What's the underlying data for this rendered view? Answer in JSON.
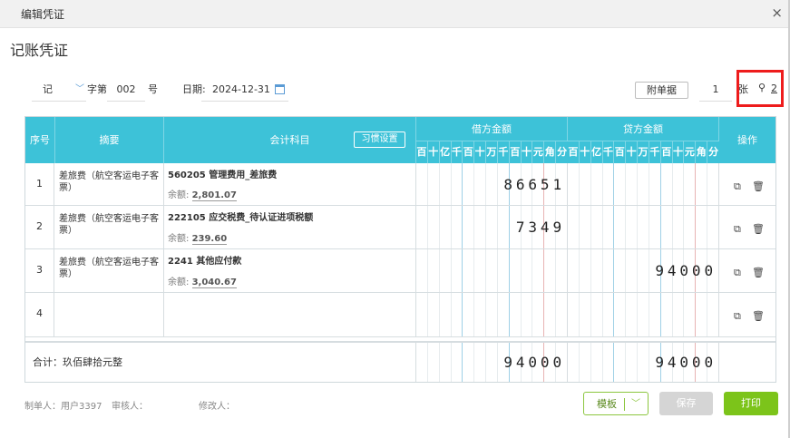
{
  "dialog": {
    "title": "编辑凭证",
    "close": "×"
  },
  "page_title": "记账凭证",
  "meta": {
    "voucher_type": "记",
    "zi_label": "字第",
    "voucher_number": "002",
    "hao_label": "号",
    "date_label": "日期:",
    "date_value": "2024-12-31",
    "attach_button": "附单据",
    "attach_count": "1",
    "zhang_label": "张",
    "link_count": "2"
  },
  "table": {
    "headers": {
      "index": "序号",
      "summary": "摘要",
      "account": "会计科目",
      "habit_button": "习惯设置",
      "debit": "借方金额",
      "credit": "贷方金额",
      "ops": "操作"
    },
    "digit_units": [
      "百",
      "十",
      "亿",
      "千",
      "百",
      "十",
      "万",
      "千",
      "百",
      "十",
      "元",
      "角",
      "分"
    ],
    "rows": [
      {
        "no": "1",
        "summary": "差旅费（航空客运电子客票）",
        "account": "560205 管理费用_差旅费",
        "balance_label": "余额:",
        "balance": "2,801.07",
        "debit": "86651",
        "credit": ""
      },
      {
        "no": "2",
        "summary": "差旅费（航空客运电子客票）",
        "account": "222105 应交税费_待认证进项税额",
        "balance_label": "余额:",
        "balance": "239.60",
        "debit": "7349",
        "credit": ""
      },
      {
        "no": "3",
        "summary": "差旅费（航空客运电子客票）",
        "account": "2241 其他应付款",
        "balance_label": "余额:",
        "balance": "3,040.67",
        "debit": "",
        "credit": "94000"
      },
      {
        "no": "4",
        "summary": "",
        "account": "",
        "balance_label": "",
        "balance": "",
        "debit": "",
        "credit": ""
      }
    ],
    "total": {
      "label": "合计：玖佰肆拾元整",
      "debit": "94000",
      "credit": "94000"
    }
  },
  "footer": {
    "maker": "制单人：用户3397",
    "reviewer": "审核人：",
    "modifier": "修改人："
  },
  "buttons": {
    "template": "模板",
    "save": "保存",
    "print": "打印"
  },
  "colors": {
    "header_bg": "#3dc2d8",
    "accent_green": "#7cc41a",
    "highlight_red": "#ee1c1c"
  },
  "icons": {
    "copy": "copy-icon",
    "delete": "trash-icon",
    "calendar": "calendar-icon",
    "link": "link-icon"
  }
}
